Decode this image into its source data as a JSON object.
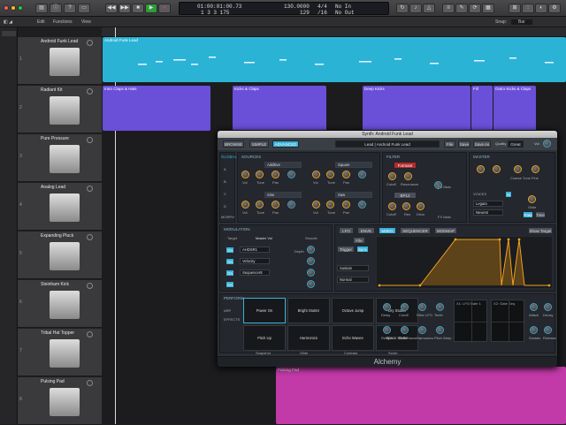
{
  "transport": {
    "position_top": "01:00:01:00.73",
    "position_bottom": "1 3 3 175",
    "tempo": "130.0000",
    "tempo_bottom": "129",
    "signature": "4/4",
    "signature_bottom": "/16",
    "midi_in": "No In",
    "midi_out": "No Out"
  },
  "toolbar": {
    "edit": "Edit",
    "functions": "Functions",
    "view": "View",
    "snap_label": "Snap:",
    "snap": "Bar"
  },
  "tracks": [
    {
      "num": "1",
      "name": "Android Funk Lead",
      "color": "#2bb3d6"
    },
    {
      "num": "2",
      "name": "Radiant Kit",
      "color": "#6a4fd8"
    },
    {
      "num": "3",
      "name": "Pure Pressure",
      "color": "#6a4fd8"
    },
    {
      "num": "4",
      "name": "Analog Lead",
      "color": "#6a4fd8"
    },
    {
      "num": "5",
      "name": "Expanding Pluck",
      "color": "#6a4fd8"
    },
    {
      "num": "6",
      "name": "Steinham Kick",
      "color": "#6a4fd8"
    },
    {
      "num": "7",
      "name": "Tribal Hat Topper",
      "color": "#6a4fd8"
    },
    {
      "num": "8",
      "name": "Pulsing Pad",
      "color": "#c13aa8"
    }
  ],
  "regions": {
    "r1": "Android Funk Lead",
    "r2a": "Intro Claps & Hats",
    "r2b": "Kicks & Claps",
    "r2c": "Deep Kicks",
    "r2d": "Fill",
    "r2e": "Outro Kicks & Claps",
    "r8": "Pulsing Pad"
  },
  "plugin": {
    "title": "Synth: Android Funk Lead",
    "browse": "BROWSE",
    "simple": "SIMPLE",
    "advanced": "ADVANCED",
    "preset": "Lead | Android Funk Lead",
    "file": "File",
    "save": "Save",
    "save_as": "Save As",
    "quality_label": "Quality",
    "quality": "Great",
    "vol": "Vol",
    "global": "GLOBAL",
    "morph": "MORPH",
    "sources_title": "SOURCES",
    "src_a": "Additive",
    "src_b": "Square",
    "src_c": "Sine",
    "src_d": "Saw",
    "src_c_mode": "F1/F2",
    "src_d_mode": "F1/F2",
    "filter_title": "FILTER",
    "filter_type": "Formant",
    "filter_type2": "BP12",
    "fx_main": "FX Main",
    "master_title": "MASTER",
    "voices_title": "VOICES",
    "voices_mode": "Legato",
    "voices_mode2": "Newest",
    "glide": "Glide",
    "coarse": "Coarse Tune Fine",
    "knobs": {
      "vol": "Vol",
      "tune": "Tune",
      "pan": "Pan",
      "cutoff": "Cutoff",
      "res": "Res",
      "drive": "Drive",
      "resonance": "Resonance"
    },
    "modulation_title": "MODULATION",
    "mod_target": "Target",
    "mod_target_val": "Master Vol",
    "mod_smooth": "Smooth",
    "mod_sources": [
      "AHDSR1",
      "Velocity",
      "Sequencer8"
    ],
    "mod_depth": "Depth",
    "mod_tabs": [
      "LFO",
      "ENVE",
      "MSEG",
      "SEQUENCER",
      "MODMAP"
    ],
    "show_target": "Show Target",
    "file2": "File",
    "trigger": "Trigger",
    "sync": "Sync",
    "sustain": "Sustain",
    "normal": "Normal",
    "perform_title": "PERFORM",
    "arp": "ARP",
    "effects": "EFFECTS",
    "perf_cells": [
      "Power On",
      "Bright Stutter",
      "Octave Jump",
      "Dry Stutter",
      "Pitch Up",
      "Harmonics",
      "Echo Wavee",
      "Space Stutter"
    ],
    "perf_bottom": [
      "Snapshot",
      "Glide",
      "Contrast",
      "Scrub"
    ],
    "macro_labels": [
      "Delay",
      "Cutoff",
      "Filter LFO",
      "Teeth",
      "Reverb",
      "Resonance",
      "Harmonics",
      "Pitch Warp"
    ],
    "xy1": "X1: LFO Rate 1",
    "xy2": "X2: Gate Seq",
    "right_labels": [
      "Attack",
      "Decay",
      "Sustain",
      "Release"
    ],
    "footer": "Alchemy"
  }
}
